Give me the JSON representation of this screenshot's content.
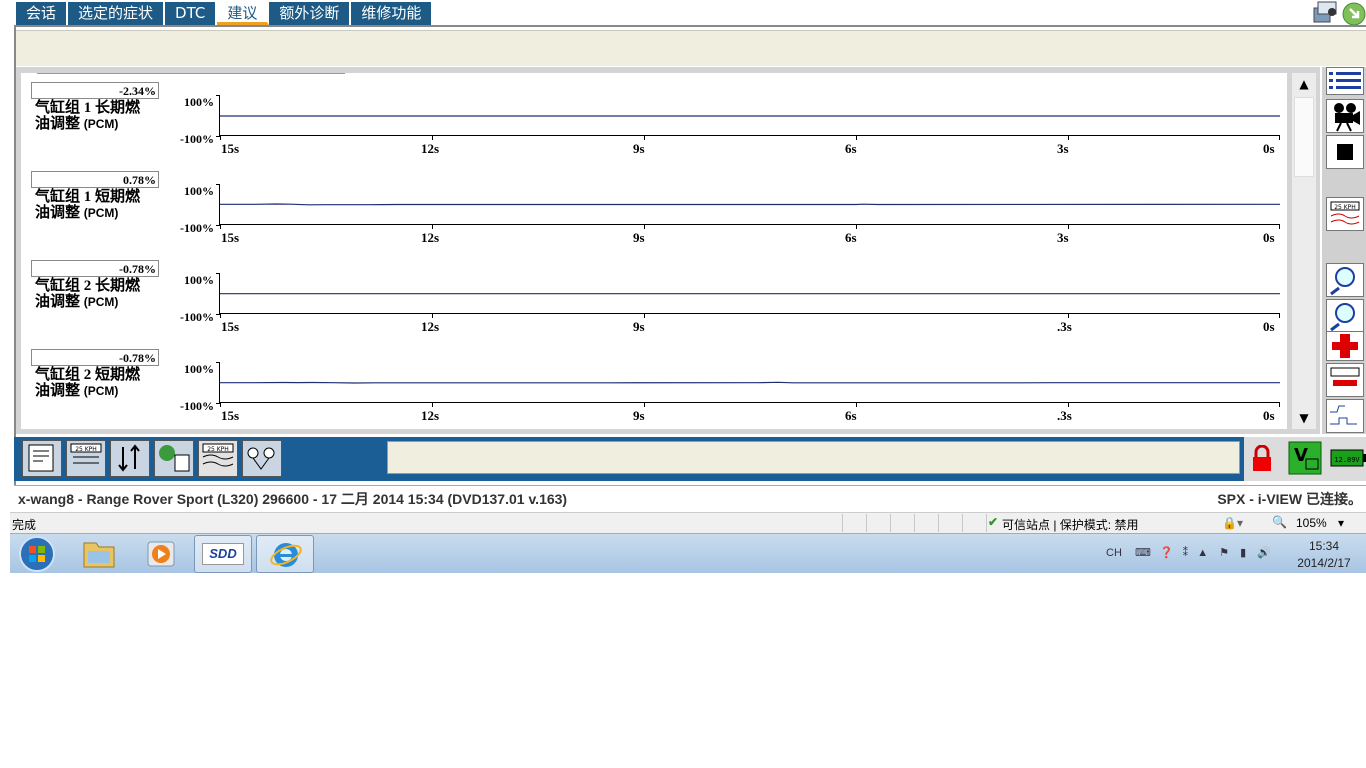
{
  "tabs": [
    "会话",
    "选定的症状",
    "DTC",
    "建议",
    "额外诊断",
    "维修功能"
  ],
  "active_tab": "建议",
  "graphs": [
    {
      "value": "-2.34%",
      "name_line1": "气缸组 1 长期燃",
      "name_line2": "油调整",
      "module": "(PCM)",
      "y_max": "100%",
      "y_min": "-100%",
      "x_labels": [
        "15s",
        "12s",
        "9s",
        "6s",
        "3s",
        "0s"
      ],
      "trace": [
        [
          0,
          -2.34
        ],
        [
          15,
          -2.34
        ]
      ]
    },
    {
      "value": "0.78%",
      "name_line1": "气缸组 1 短期燃",
      "name_line2": "油调整",
      "module": "(PCM)",
      "y_max": "100%",
      "y_min": "-100%",
      "x_labels": [
        "15s",
        "12s",
        "9s",
        "6s",
        "3s",
        "0s"
      ],
      "trace": [
        [
          0,
          0.78
        ],
        [
          0.5,
          0.78
        ],
        [
          0.8,
          2.3
        ],
        [
          1.0,
          1.6
        ],
        [
          1.25,
          -1.6
        ],
        [
          1.5,
          -0.8
        ],
        [
          2.1,
          -0.8
        ],
        [
          2.5,
          0.0
        ],
        [
          9.0,
          0.0
        ],
        [
          9.1,
          1.5
        ],
        [
          9.3,
          0.0
        ],
        [
          15,
          0.78
        ]
      ]
    },
    {
      "value": "-0.78%",
      "name_line1": "气缸组 2 长期燃",
      "name_line2": "油调整",
      "module": "(PCM)",
      "y_max": "100%",
      "y_min": "-100%",
      "x_labels": [
        "15s",
        "12s",
        "9s",
        ".3s",
        "0s"
      ],
      "trace": [
        [
          0,
          -0.78
        ],
        [
          15,
          -0.78
        ]
      ]
    },
    {
      "value": "-0.78%",
      "name_line1": "气缸组 2 短期燃",
      "name_line2": "油调整",
      "module": "(PCM)",
      "y_max": "100%",
      "y_min": "-100%",
      "x_labels": [
        "15s",
        "12s",
        "9s",
        "6s",
        ".3s",
        "0s"
      ],
      "trace": [
        [
          0,
          -0.78
        ],
        [
          0.5,
          -0.78
        ],
        [
          0.9,
          0.0
        ],
        [
          1.1,
          -0.6
        ],
        [
          1.3,
          0.0
        ],
        [
          1.6,
          -0.8
        ],
        [
          1.9,
          -2.3
        ],
        [
          2.2,
          -1.5
        ],
        [
          5.5,
          -1.5
        ],
        [
          7.6,
          -0.8
        ],
        [
          7.9,
          0.8
        ],
        [
          8.1,
          -1.5
        ],
        [
          10.2,
          -1.5
        ],
        [
          11.3,
          -1.5
        ],
        [
          11.8,
          -0.78
        ],
        [
          15,
          -0.78
        ]
      ]
    }
  ],
  "bottom_toolbar": {
    "icon_label": "25 KPH"
  },
  "battery_label": "12.89V",
  "vehicle_info": "x-wang8 - Range Rover Sport (L320) 296600 - 17 二月 2014 15:34 (DVD137.01 v.163)",
  "connection_info": "SPX - i-VIEW 已连接。",
  "ie_status": {
    "done": "完成",
    "trust": "可信站点 | 保护模式: 禁用",
    "zoom": "105%"
  },
  "taskbar": {
    "sdd_label": "SDD",
    "lang": "CH",
    "time": "15:34",
    "date": "2014/2/17"
  },
  "colors": {
    "tab_blue": "#1d5a85",
    "bottom_blue": "#1b5e96",
    "trace": "#1f2f72",
    "active_tab_underline": "#f0a020"
  }
}
